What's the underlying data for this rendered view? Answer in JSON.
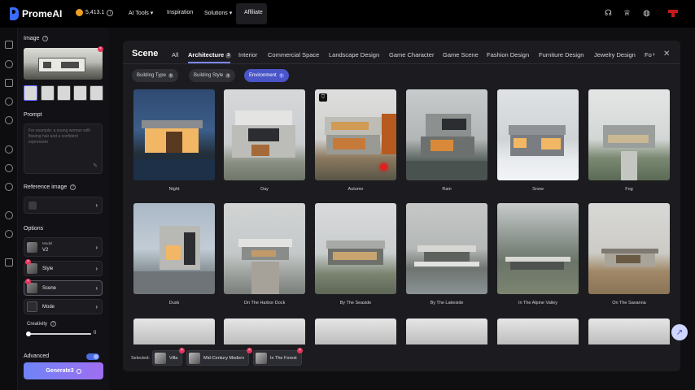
{
  "app": {
    "logo_text": "PromeAI",
    "credits": "5,413.1",
    "info_glyph": "i"
  },
  "nav": {
    "ai_tools": "AI Tools ▾",
    "inspiration": "Inspiration",
    "solutions": "Solutions ▾",
    "affiliate": "Affiliate"
  },
  "topbar_icons": [
    "headset-icon",
    "crown-icon",
    "globe-icon"
  ],
  "panel": {
    "image_label": "Image",
    "prompt_label": "Prompt",
    "prompt_placeholder": "For example: a young woman with flowing hair and a confident expression",
    "reference_label": "Reference image",
    "options_label": "Options",
    "model_label": "Model",
    "model_value": "V2",
    "style_label": "Style",
    "scene_label": "Scene",
    "mode_label": "Mode",
    "creativity_label": "Creativity",
    "creativity_value": "0",
    "creativity_level": 0,
    "advanced_label": "Advanced",
    "advanced_on": true,
    "generate_label": "Generate3"
  },
  "modal": {
    "title": "Scene",
    "tabs": [
      {
        "label": "All"
      },
      {
        "label": "Architecture",
        "count": "3",
        "active": true
      },
      {
        "label": "Interior"
      },
      {
        "label": "Commercial Space"
      },
      {
        "label": "Landscape Design"
      },
      {
        "label": "Game Character"
      },
      {
        "label": "Game Scene"
      },
      {
        "label": "Fashion Design"
      },
      {
        "label": "Furniture Design"
      },
      {
        "label": "Jewelry Design"
      },
      {
        "label": "Fo"
      }
    ],
    "next_glyph": "›",
    "close_glyph": "✕",
    "chips": [
      {
        "label": "Building Type",
        "count": "1"
      },
      {
        "label": "Building Style",
        "count": "1"
      },
      {
        "label": "Environment",
        "count": "1",
        "active": true
      }
    ],
    "cards_row1": [
      "Night",
      "Day",
      "Autumn",
      "Rain",
      "Snow",
      "Fog"
    ],
    "cards_row2": [
      "Dusk",
      "On The Harbor Dock",
      "By The Seaside",
      "By The Lakeside",
      "In The Alpine Valley",
      "On The Savanna"
    ],
    "selected_label": "Selected:",
    "selected": [
      "Villa",
      "Mid-Century Modern",
      "In The Forest"
    ]
  },
  "colors": {
    "accent": "#7b88ff",
    "generate_start": "#6f84f8",
    "generate_end": "#9f6ef0",
    "badge": "#e8345c"
  }
}
